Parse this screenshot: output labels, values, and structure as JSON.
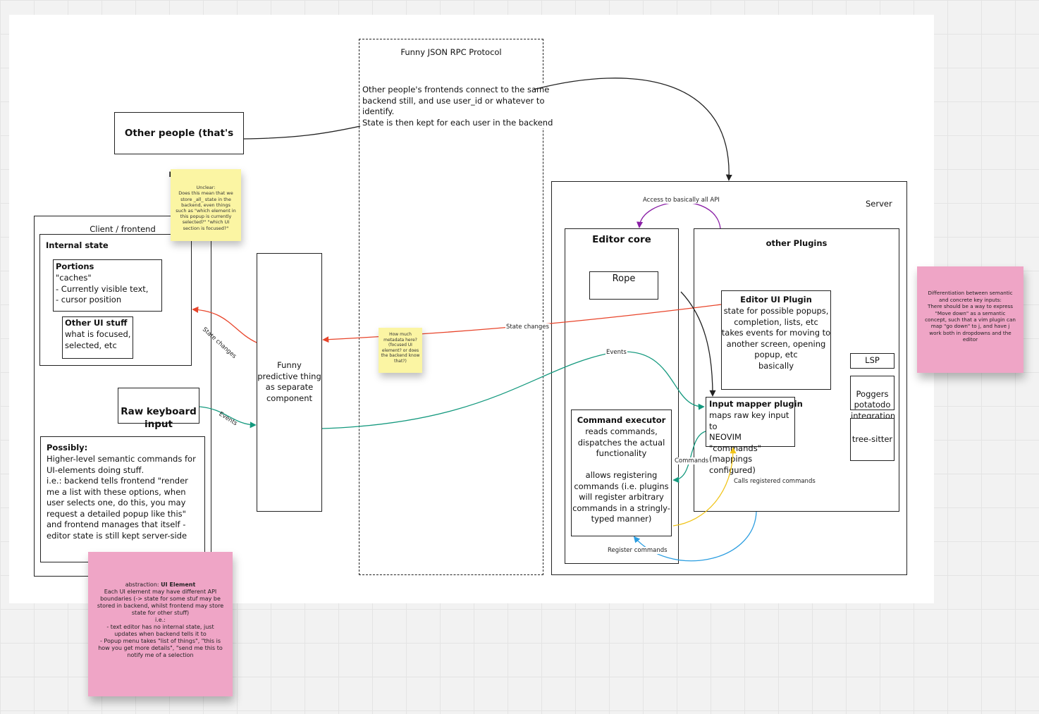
{
  "protocol": {
    "title": "Funny JSON RPC Protocol",
    "note": "Other people's frontends connect to the same\nbackend still, and use user_id or whatever to identify.\nState is then kept for each user in the backend"
  },
  "other_people": "Other people (that's me)",
  "client": {
    "title": "Client / frontend",
    "internal_state": "Internal state",
    "portions_title": "Portions",
    "portions_body": "\"caches\"\n- Currently visible text,\n- cursor position",
    "other_ui_title": "Other UI stuff",
    "other_ui_body": "what is focused,\nselected, etc",
    "raw_keyboard": "Raw keyboard\ninput",
    "possibly_title": "Possibly:",
    "possibly_body": "Higher-level semantic commands for UI-elements doing stuff.\ni.e.: backend tells frontend \"render me a list with these options, when user selects one, do this, you may request a detailed popup like this\"\nand frontend manages that itself - editor state is still kept server-side"
  },
  "predictive": "Funny\npredictive thing\nas separate\ncomponent",
  "server": {
    "title": "Server",
    "editor_core": "Editor core",
    "rope": "Rope",
    "command_executor_title": "Command executor",
    "command_executor_body": "reads commands,\ndispatches the actual\nfunctionality\n\nallows registering\ncommands (i.e. plugins\nwill register arbitrary\ncommands in a stringly-\ntyped manner)",
    "other_plugins": "other Plugins",
    "editor_ui_title": "Editor UI Plugin",
    "editor_ui_body": "state for possible popups,\ncompletion, lists, etc\ntakes events for moving to\nanother screen, opening\npopup, etc\nbasically",
    "input_mapper_title": "Input mapper plugin",
    "input_mapper_body": "maps raw key input to\nNEOVIM \"commands\"\n(mappings configured)",
    "lsp": "LSP",
    "poggers": "Poggers\npotatodo\nintegration",
    "tree_sitter": "tree-sitter"
  },
  "labels": {
    "access_api": "Access to basically all API",
    "state_changes_1": "State changes",
    "state_changes_2": "State changes",
    "events_1": "Events",
    "events_2": "Events",
    "commands": "Commands",
    "calls_registered": "Calls registered commands",
    "register_commands": "Register commands"
  },
  "stickies": {
    "unclear": "Unclear:\nDoes this mean that we store _all_ state in the backend, even things such as \"which element in this popup is currently selected?\" \"which UI section is focused?\"",
    "metadata": "How much metadata here? (focused UI element? or does the backend know that?)",
    "differentiation": "Differentiation between semantic and concrete key inputs:\nThere should be a way to express \"Move down\" as a semantic concept, such that a vim plugin can map \"go down\" to j, and have j work both in dropdowns and the editor",
    "ui_element_prefix": "abstraction: ",
    "ui_element_title": "UI Element",
    "ui_element_body": "Each UI element may have different API boundaries (-> state for some stuf may be stored in backend, whilst frontend may store state for other stuff)\ni.e.:\n- text editor has no internal state, just updates when backend tells it to\n- Popup menu takes \"list of things\", \"this is how you get more details\", \"send me this to notify me of a selection"
  },
  "colors": {
    "state_changes": "#e8442a",
    "events": "#14997e",
    "access": "#8a1fa6",
    "calls": "#f0c419",
    "register": "#2a9de0",
    "sticky_yellow": "#fbf5a3",
    "sticky_pink": "#efa5c6"
  }
}
